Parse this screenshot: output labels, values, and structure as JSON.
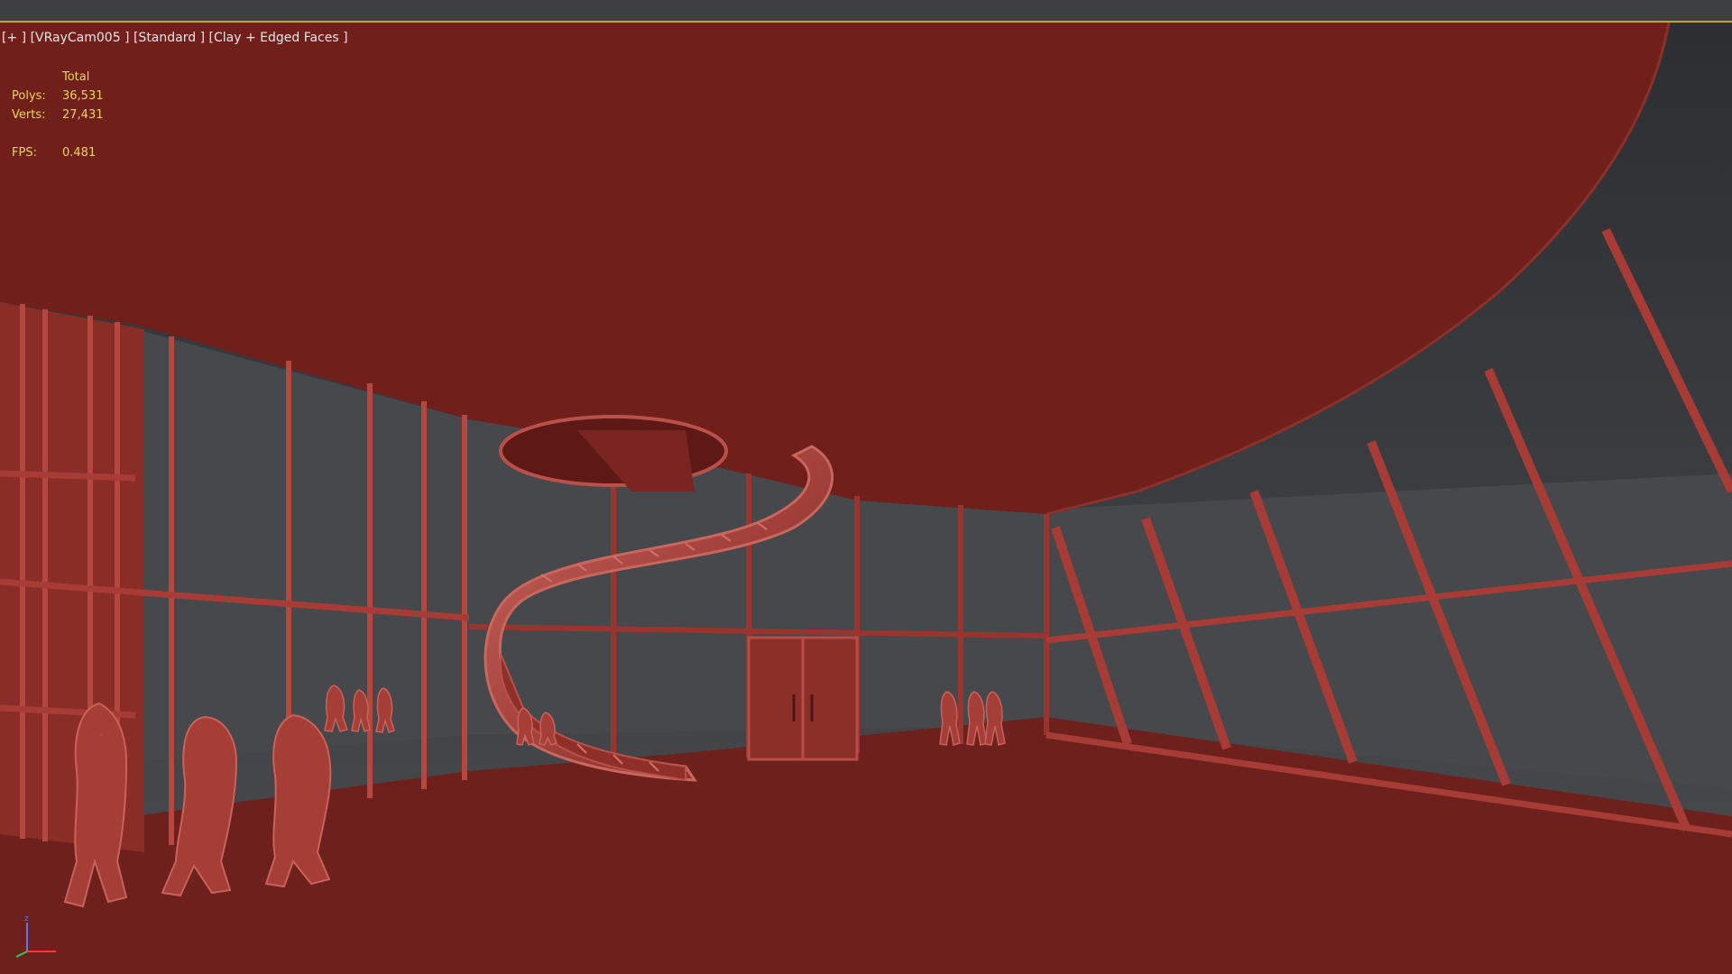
{
  "viewport": {
    "label_menu": "[+ ]",
    "label_camera": "[VRayCam005 ]",
    "label_shading": "[Standard ]",
    "label_style": "[Clay + Edged Faces ]"
  },
  "stats": {
    "header": "Total",
    "polys_label": "Polys:",
    "polys_value": "36,531",
    "verts_label": "Verts:",
    "verts_value": "27,431",
    "fps_label": "FPS:",
    "fps_value": "0.481"
  },
  "colors": {
    "clay": "#6f201b",
    "clay_light": "#b2473f",
    "clay_edge": "#c0564d",
    "background": "#3a3b3d",
    "stats_text": "#e8d55b",
    "label_text": "#e6e6e6",
    "accent_line": "#c9a227"
  },
  "icons": {
    "axis": "axis-tripod-icon"
  }
}
